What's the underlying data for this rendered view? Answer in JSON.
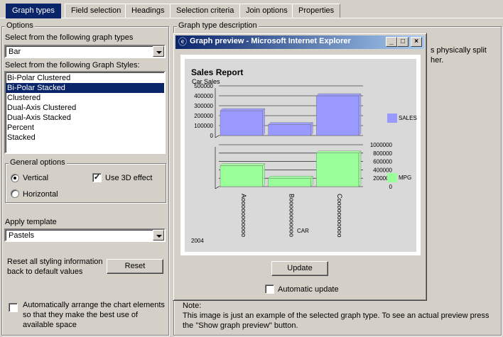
{
  "tabs": [
    {
      "label": "Graph types",
      "active": true
    },
    {
      "label": "Field selection",
      "active": false
    },
    {
      "label": "Headings",
      "active": false
    },
    {
      "label": "Selection criteria",
      "active": false
    },
    {
      "label": "Join options",
      "active": false
    },
    {
      "label": "Properties",
      "active": false
    }
  ],
  "options": {
    "group_label": "Options",
    "graph_type_label": "Select from the following graph types",
    "graph_type_value": "Bar",
    "styles_label": "Select from the following Graph Styles:",
    "styles": [
      {
        "label": "Bi-Polar Clustered",
        "selected": false
      },
      {
        "label": "Bi-Polar Stacked",
        "selected": true
      },
      {
        "label": "Clustered",
        "selected": false
      },
      {
        "label": "Dual-Axis Clustered",
        "selected": false
      },
      {
        "label": "Dual-Axis Stacked",
        "selected": false
      },
      {
        "label": "Percent",
        "selected": false
      },
      {
        "label": "Stacked",
        "selected": false
      }
    ],
    "general_label": "General options",
    "vertical_label": "Vertical",
    "horizontal_label": "Horizontal",
    "orientation": "vertical",
    "use3d_label": "Use 3D effect",
    "use3d_checked": true,
    "apply_template_label": "Apply template",
    "template_value": "Pastels",
    "reset_text_1": "Reset all styling information",
    "reset_text_2": "back to default values",
    "reset_button": "Reset",
    "auto_arrange_1": "Automatically arrange the chart elements",
    "auto_arrange_2": "so that they make the best use of",
    "auto_arrange_3": "available space",
    "auto_arrange_checked": false
  },
  "description": {
    "group_label": "Graph type description",
    "partial_text_1": "s physically split",
    "partial_text_2": "her.",
    "note_label": "Note:",
    "note_line_1": "This image is just an example of the selected graph type. To see an actual preview press",
    "note_line_2": "the \"Show graph preview\" button."
  },
  "preview_window": {
    "title": "Graph preview - Microsoft Internet Explorer",
    "update_button": "Update",
    "auto_update_label": "Automatic update",
    "auto_update_checked": false,
    "colors": {
      "sales": "#9999ff",
      "mpg": "#99ff99"
    }
  },
  "chart_data": {
    "type": "bar",
    "title": "Sales Report",
    "subtitle": "Car Sales",
    "xlabel": "CAR",
    "footer": "2004",
    "categories": [
      "Aooooooooooo",
      "Booooooooooo",
      "Cooooooooooo"
    ],
    "series": [
      {
        "name": "SALES",
        "values": [
          250000,
          110000,
          400000
        ],
        "ylim": [
          0,
          500000
        ],
        "ticks": [
          "500000",
          "400000",
          "300000",
          "200000",
          "100000",
          "0"
        ]
      },
      {
        "name": "MPG",
        "values": [
          500000,
          200000,
          800000
        ],
        "ylim": [
          0,
          1000000
        ],
        "ticks": [
          "1000000",
          "800000",
          "600000",
          "400000",
          "200000",
          "0"
        ]
      }
    ],
    "legend": "right"
  }
}
